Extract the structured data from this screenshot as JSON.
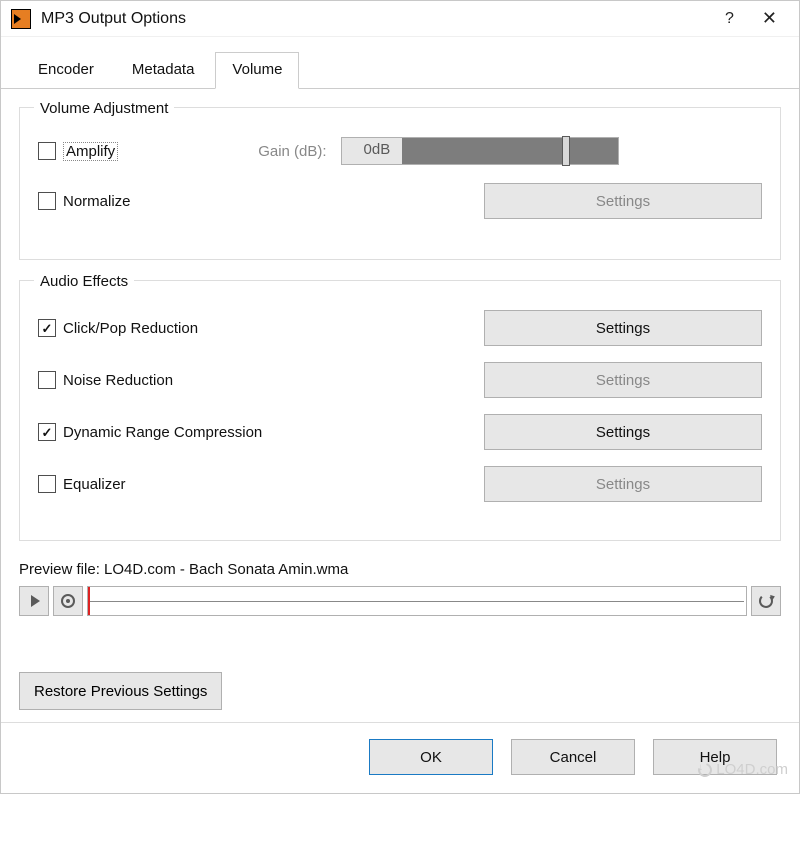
{
  "title": "MP3 Output Options",
  "tabs": [
    "Encoder",
    "Metadata",
    "Volume"
  ],
  "active_tab": 2,
  "volume_adjustment": {
    "label": "Volume Adjustment",
    "amplify": {
      "label": "Amplify",
      "checked": false
    },
    "normalize": {
      "label": "Normalize",
      "checked": false
    },
    "gain_label": "Gain (dB):",
    "gain_text": "0dB",
    "settings_label": "Settings"
  },
  "audio_effects": {
    "label": "Audio Effects",
    "items": [
      {
        "label": "Click/Pop Reduction",
        "checked": true,
        "settings_enabled": true
      },
      {
        "label": "Noise Reduction",
        "checked": false,
        "settings_enabled": false
      },
      {
        "label": "Dynamic Range Compression",
        "checked": true,
        "settings_enabled": true
      },
      {
        "label": "Equalizer",
        "checked": false,
        "settings_enabled": false
      }
    ],
    "settings_label": "Settings"
  },
  "preview": {
    "label": "Preview file: LO4D.com - Bach Sonata Amin.wma"
  },
  "restore_label": "Restore Previous Settings",
  "footer": {
    "ok": "OK",
    "cancel": "Cancel",
    "help": "Help"
  },
  "watermark": "LO4D.com"
}
